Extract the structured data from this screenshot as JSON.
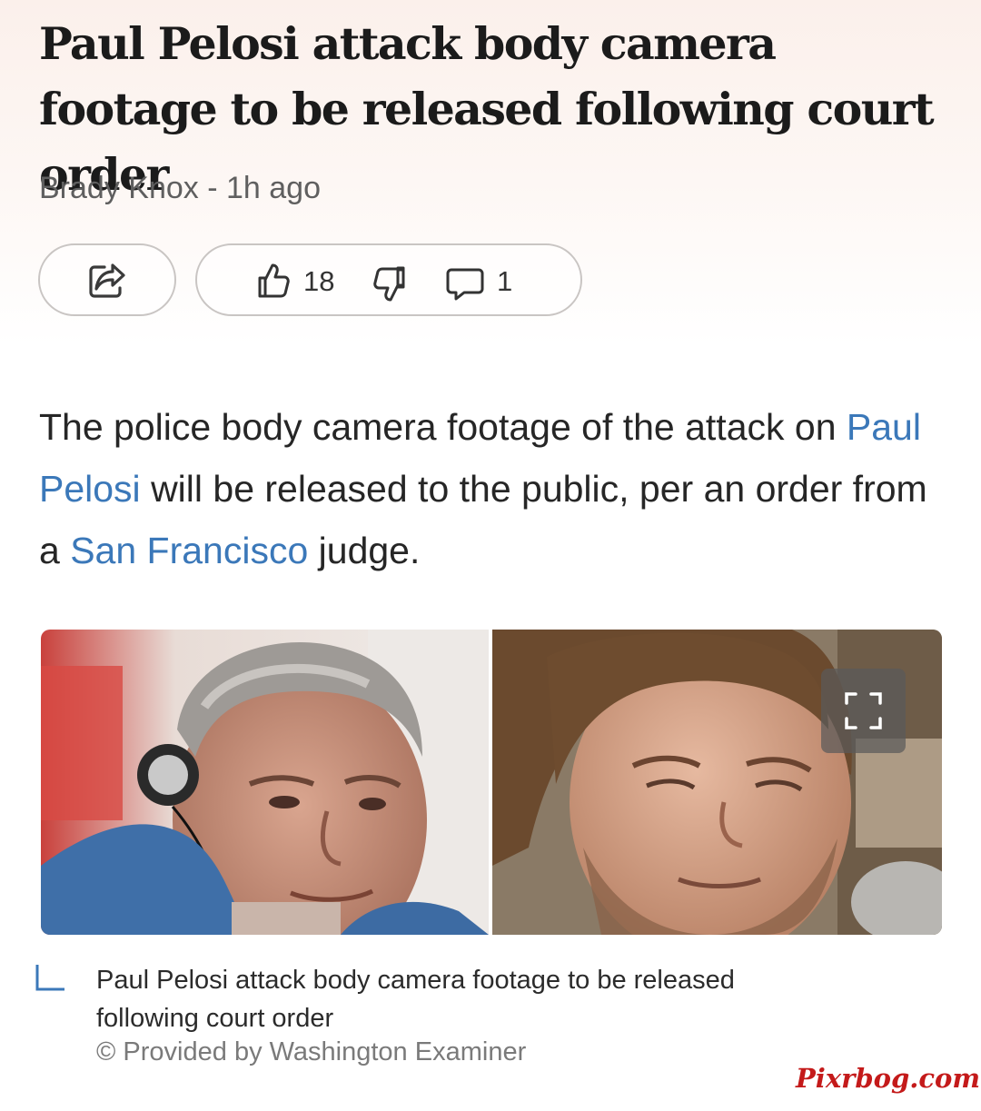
{
  "article": {
    "headline": "Paul Pelosi attack body camera footage to be released following court order",
    "author": "Brady Knox",
    "separator": " - ",
    "time_ago": "1h ago",
    "lede": {
      "part1": "The police body camera footage of the attack on ",
      "link1": "Paul Pelosi",
      "part2": " will be released to the public, per an order from a ",
      "link2": "San Francisco",
      "part3": " judge."
    }
  },
  "actions": {
    "share_icon": "share-icon",
    "like_icon": "thumbs-up-icon",
    "likes": "18",
    "dislike_icon": "thumbs-down-icon",
    "comment_icon": "comment-icon",
    "comments": "1"
  },
  "figure": {
    "expand_icon": "expand-icon",
    "caption_icon": "corner-bracket-icon",
    "caption": "Paul Pelosi attack body camera footage to be released following court order",
    "credit": "© Provided by Washington Examiner"
  },
  "watermark": "Pixrbog.com",
  "colors": {
    "link": "#3b78b9",
    "watermark": "#c41a1a",
    "pill_border": "#c9c5c3"
  }
}
